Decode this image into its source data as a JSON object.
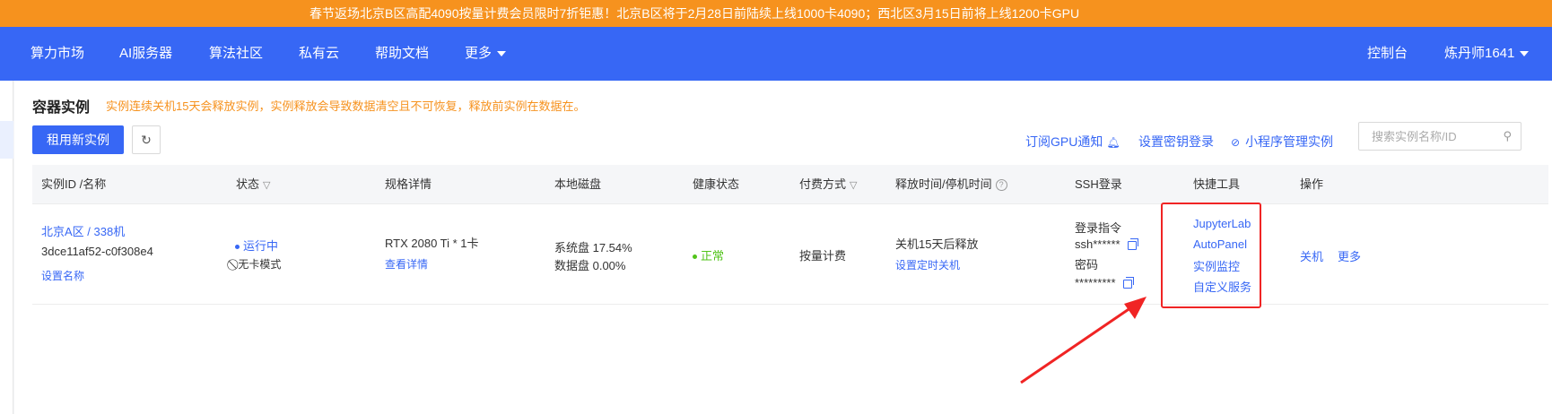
{
  "banner": {
    "text": "春节返场北京B区高配4090按量计费会员限时7折钜惠！北京B区将于2月28日前陆续上线1000卡4090；西北区3月15日前将上线1200卡GPU"
  },
  "nav": {
    "items": [
      "算力市场",
      "AI服务器",
      "算法社区",
      "私有云",
      "帮助文档",
      "更多"
    ],
    "console": "控制台",
    "user": "炼丹师1641"
  },
  "page": {
    "title": "容器实例",
    "notice": "实例连续关机15天会释放实例，实例释放会导致数据清空且不可恢复，释放前实例在数据在。",
    "new_button": "租用新实例",
    "refresh_icon": "refresh-icon",
    "links": {
      "subscribe": "订阅GPU通知",
      "ssh_key": "设置密钥登录",
      "miniapp": "小程序管理实例"
    },
    "search_placeholder": "搜索实例名称/ID"
  },
  "table": {
    "headers": [
      "实例ID /名称",
      "状态",
      "规格详情",
      "本地磁盘",
      "健康状态",
      "付费方式",
      "释放时间/停机时间",
      "SSH登录",
      "快捷工具",
      "操作"
    ],
    "row": {
      "region": "北京A区 / 338机",
      "id": "3dce11af52-c0f308e4",
      "set_name": "设置名称",
      "status": "运行中",
      "mode": "无卡模式",
      "spec": "RTX 2080 Ti * 1卡",
      "spec_detail": "查看详情",
      "disk_system": "系统盘 17.54%",
      "disk_data": "数据盘 0.00%",
      "health": "正常",
      "billing": "按量计费",
      "release": "关机15天后释放",
      "schedule": "设置定时关机",
      "ssh": {
        "cmd_label": "登录指令",
        "cmd": "ssh******",
        "pwd_label": "密码",
        "pwd": "*********"
      },
      "tools": [
        "JupyterLab",
        "AutoPanel",
        "实例监控",
        "自定义服务"
      ],
      "actions": [
        "关机",
        "更多"
      ]
    }
  },
  "colors": {
    "accent": "#3767f5",
    "banner": "#f6921e",
    "highlight": "#f02424",
    "ok": "#52c41a"
  }
}
